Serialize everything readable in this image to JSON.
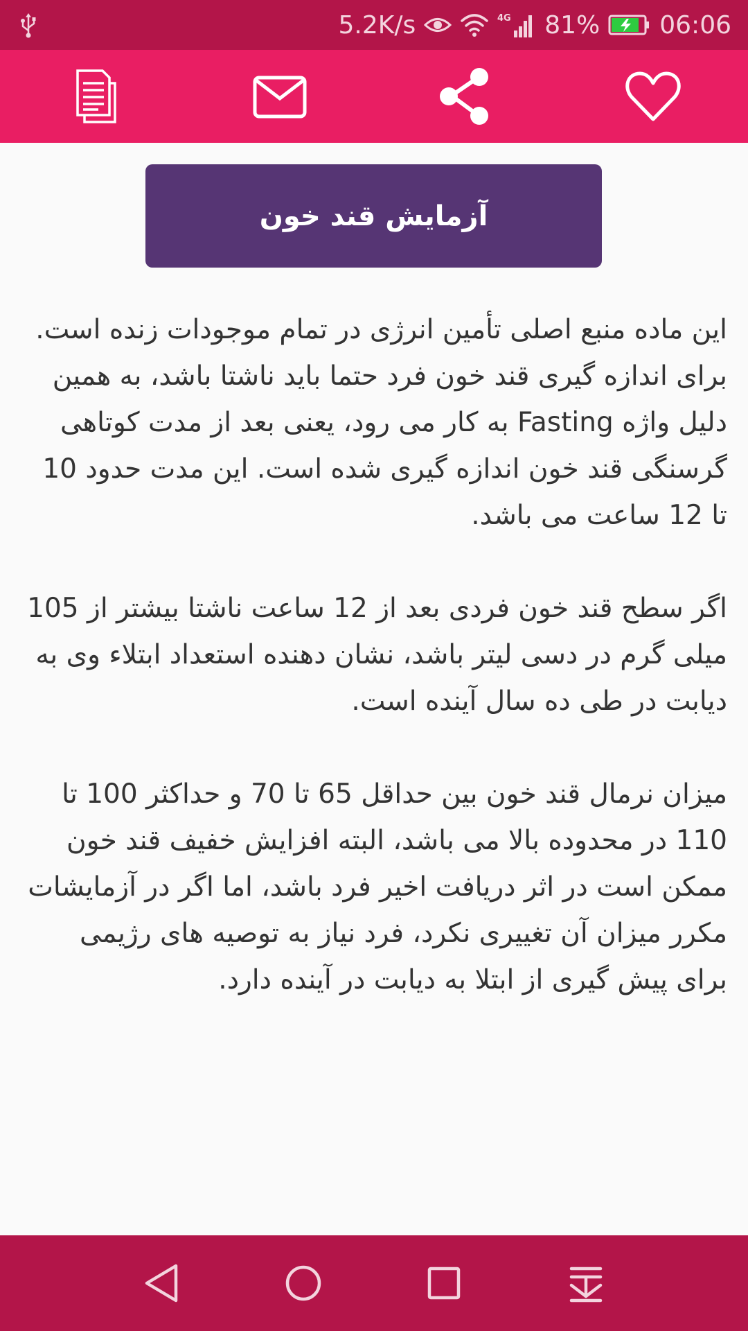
{
  "status_bar": {
    "speed": "5.2K/s",
    "network": "4G",
    "battery": "81%",
    "time": "06:06"
  },
  "app_bar": {
    "icons": [
      "copy-icon",
      "mail-icon",
      "share-icon",
      "heart-icon"
    ]
  },
  "title": "آزمایش قند خون",
  "paragraphs": [
    "این ماده منبع اصلی تأمین انرژی در تمام موجودات زنده است. برای اندازه گیری قند خون فرد حتما باید ناشتا باشد، به همین دلیل واژه Fasting به کار می رود، یعنی بعد از مدت کوتاهی گرسنگی قند خون اندازه گیری شده است. این مدت حدود 10 تا 12 ساعت می باشد.",
    "اگر سطح قند خون فردی بعد از 12 ساعت ناشتا بیشتر از 105 میلی گرم در دسی لیتر باشد، نشان دهنده استعداد ابتلاء وی به دیابت در طی ده سال آینده است.",
    "میزان نرمال قند خون بین حداقل 65 تا 70 و حداکثر 100 تا 110 در محدوده بالا می باشد، البته افزایش خفیف قند خون ممکن است در اثر دریافت اخیر فرد باشد، اما اگر در آزمایشات مکرر میزان آن تغییری نکرد، فرد نیاز به توصیه های رژیمی برای پیش گیری از ابتلا به دیابت در آینده دارد."
  ],
  "colors": {
    "status_bar": "#b31549",
    "app_bar": "#e91e63",
    "title_card": "#563574",
    "background": "#fafafa",
    "text": "#333333"
  }
}
